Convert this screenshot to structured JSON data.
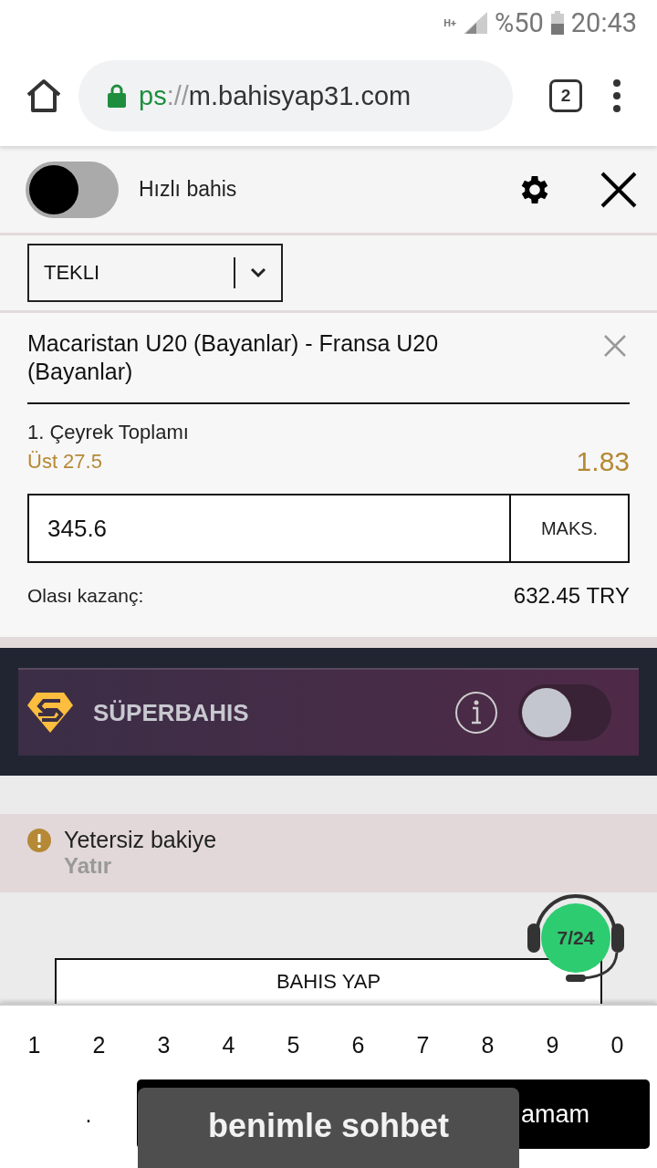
{
  "status_bar": {
    "network_type": "H+",
    "battery": "%50",
    "time": "20:43"
  },
  "browser": {
    "url_scheme": "ps",
    "url_separator": "://",
    "url_host": "m.bahisyap31.com",
    "tab_count": "2"
  },
  "quick_bet": {
    "label": "Hızlı bahis",
    "on": false
  },
  "bet_type": {
    "value": "TEKLI"
  },
  "bet": {
    "match": "Macaristan U20 (Bayanlar) - Fransa U20 (Bayanlar)",
    "market": "1. Çeyrek Toplamı",
    "selection": "Üst 27.5",
    "odds": "1.83",
    "stake": "345.6",
    "max_button": "MAKS.",
    "win_label": "Olası kazanç:",
    "win_value": "632.45 TRY"
  },
  "superbahis": {
    "label": "SÜPERBAHIS",
    "on": false
  },
  "warning": {
    "message": "Yetersiz bakiye",
    "link": "Yatır"
  },
  "place_bet": "BAHIS YAP",
  "chat_badge": "7/24",
  "keyboard": {
    "digits": [
      "1",
      "2",
      "3",
      "4",
      "5",
      "6",
      "7",
      "8",
      "9",
      "0"
    ],
    "dot": ".",
    "done": "amam"
  },
  "chat_overlay": "benimle sohbet"
}
